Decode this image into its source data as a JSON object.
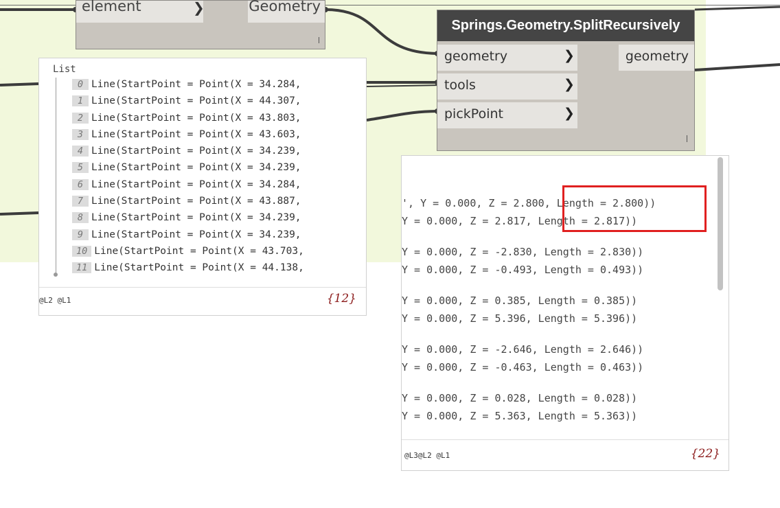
{
  "node_element": {
    "input_label": "element",
    "output_label": "Geometry"
  },
  "node_split": {
    "title": "Springs.Geometry.SplitRecursively",
    "inputs": [
      "geometry",
      "tools",
      "pickPoint"
    ],
    "output": "geometry"
  },
  "list_preview": {
    "title": "List",
    "items": [
      {
        "index": "0",
        "text": "Line(StartPoint = Point(X = 34.284,"
      },
      {
        "index": "1",
        "text": "Line(StartPoint = Point(X = 44.307,"
      },
      {
        "index": "2",
        "text": "Line(StartPoint = Point(X = 43.803,"
      },
      {
        "index": "3",
        "text": "Line(StartPoint = Point(X = 43.603,"
      },
      {
        "index": "4",
        "text": "Line(StartPoint = Point(X = 34.239,"
      },
      {
        "index": "5",
        "text": "Line(StartPoint = Point(X = 34.239,"
      },
      {
        "index": "6",
        "text": "Line(StartPoint = Point(X = 34.284,"
      },
      {
        "index": "7",
        "text": "Line(StartPoint = Point(X = 43.887,"
      },
      {
        "index": "8",
        "text": "Line(StartPoint = Point(X = 34.239,"
      },
      {
        "index": "9",
        "text": "Line(StartPoint = Point(X = 34.239,"
      },
      {
        "index": "10",
        "text": "Line(StartPoint = Point(X = 43.703,"
      },
      {
        "index": "11",
        "text": "Line(StartPoint = Point(X = 44.138,"
      }
    ],
    "levels": "@L2 @L1",
    "count": "{12}"
  },
  "split_preview": {
    "lines": [
      "', Y = 0.000, Z = 2.800, Length = 2.800))",
      " Y = 0.000, Z = 2.817, Length = 2.817))",
      " Y = 0.000, Z = -2.830, Length = 2.830))",
      " Y = 0.000, Z = -0.493, Length = 0.493))",
      " Y = 0.000, Z = 0.385, Length = 0.385))",
      " Y = 0.000, Z = 5.396, Length = 5.396))",
      " Y = 0.000, Z = -2.646, Length = 2.646))",
      " Y = 0.000, Z = -0.463, Length = 0.463))",
      " Y = 0.000, Z = 0.028, Length = 0.028))",
      " Y = 0.000, Z = 5.363, Length = 5.363))"
    ],
    "levels": "@L3@L2 @L1",
    "count": "{22}"
  },
  "colors": {
    "highlight": "#e02020",
    "node_title_bg": "#454545",
    "group_bg": "#f2f8dc",
    "count_color": "#8b1a1a"
  }
}
